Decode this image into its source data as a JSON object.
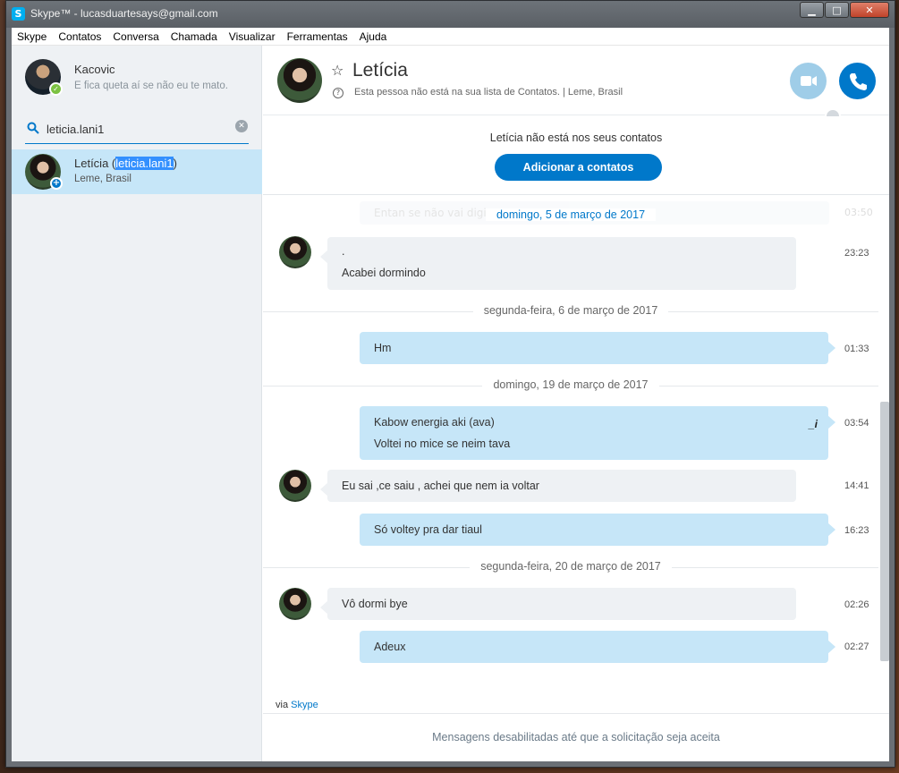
{
  "window": {
    "title": "Skype™ - lucasduartesays@gmail.com",
    "logo_letter": "S",
    "min": "▁",
    "max": "□",
    "close": "✕"
  },
  "menu": [
    "Skype",
    "Contatos",
    "Conversa",
    "Chamada",
    "Visualizar",
    "Ferramentas",
    "Ajuda"
  ],
  "profile": {
    "name": "Kacovic",
    "mood": "E fica queta aí se não eu te mato.",
    "status": "online"
  },
  "search": {
    "value": "leticia.lani1",
    "clear_icon": "clear-icon"
  },
  "result": {
    "name_prefix": "Letícia (",
    "name_highlight": "leticia.lani1",
    "name_suffix": ")",
    "location": "Leme, Brasil"
  },
  "contact": {
    "name": "Letícia",
    "info": "Esta pessoa não está na sua lista de Contatos.  |  Leme, Brasil"
  },
  "add_contact": {
    "text": "Letícia não está nos seus contatos",
    "button": "Adicionar a contatos"
  },
  "conversation": {
    "ghost_text": "Entan se não vai digitar",
    "ghost_time": "03:50",
    "dates": [
      "domingo, 5 de março de 2017",
      "segunda-feira, 6 de março de 2017",
      "domingo, 19 de março de 2017",
      "segunda-feira, 20 de março de 2017"
    ],
    "messages": [
      {
        "dir": "in",
        "lines": [
          ".",
          "Acabei dormindo"
        ],
        "time": "23:23"
      },
      {
        "dir": "out",
        "lines": [
          "Hm"
        ],
        "time": "01:33"
      },
      {
        "dir": "out",
        "lines": [
          "Kabow energia aki (ava)",
          "Voltei no mice se neim tava"
        ],
        "time": "03:54",
        "edited_mark": "_i"
      },
      {
        "dir": "in",
        "lines": [
          "Eu sai ,ce saiu , achei que nem ia voltar"
        ],
        "time": "14:41"
      },
      {
        "dir": "out",
        "lines": [
          "Só voltey pra dar tiaul"
        ],
        "time": "16:23"
      },
      {
        "dir": "in",
        "lines": [
          "Vô dormi bye"
        ],
        "time": "02:26"
      },
      {
        "dir": "out",
        "lines": [
          "Adeux"
        ],
        "time": "02:27"
      }
    ]
  },
  "via": {
    "prefix": "via ",
    "link": "Skype"
  },
  "footer": {
    "disabled_text": "Mensagens desabilitadas até que a solicitação seja aceita"
  },
  "colors": {
    "accent": "#0078ca",
    "outgoing": "#c6e6f8",
    "incoming": "#eef1f4",
    "online": "#7cc242"
  }
}
